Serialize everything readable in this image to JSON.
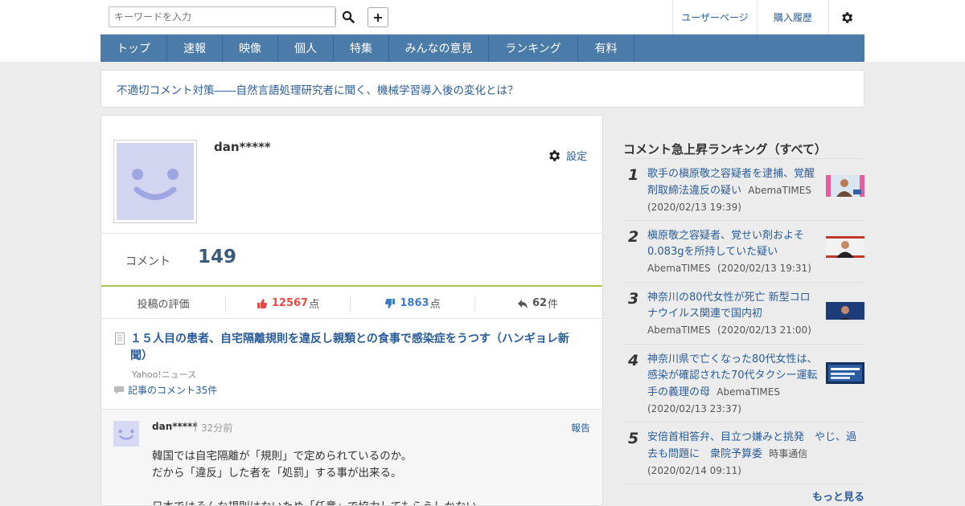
{
  "header": {
    "search_placeholder": "キーワードを入力",
    "links": {
      "user_page": "ユーザーページ",
      "purchase_history": "購入履歴"
    }
  },
  "nav": {
    "items": [
      "トップ",
      "速報",
      "映像",
      "個人",
      "特集",
      "みんなの意見",
      "ランキング",
      "有料"
    ]
  },
  "notice": {
    "text": "不適切コメント対策――自然言語処理研究者に聞く、機械学習導入後の変化とは？"
  },
  "profile": {
    "username": "dan*****",
    "settings_label": "設定"
  },
  "comment_count": {
    "label": "コメント",
    "value": "149"
  },
  "ratings": {
    "label": "投稿の評価",
    "likes": "12567",
    "likes_unit": "点",
    "dislikes": "1863",
    "dislikes_unit": "点",
    "replies": "62",
    "replies_unit": "件"
  },
  "article": {
    "title": "１５人目の患者、自宅隔離規則を違反し親類との食事で感染症をうつす（ハンギョレ新聞）",
    "source": "Yahoo!ニュース",
    "comments_link": "記事のコメント35件"
  },
  "comment": {
    "author": "dan*****",
    "separator": "|",
    "time": "32分前",
    "report": "報告",
    "lines": [
      "韓国では自宅隔離が「規則」で定められているのか。",
      "だから「違反」した者を「処罰」する事が出来る。",
      "",
      "日本ではそんな規則はないため「任意」で協力してもらうしかない。"
    ]
  },
  "ranking": {
    "title": "コメント急上昇ランキング（すべて）",
    "more": "もっと見る",
    "items": [
      {
        "rank": "1",
        "title": "歌手の槇原敬之容疑者を逮捕、覚醒剤取締法違反の疑い",
        "source": "AbemaTIMES",
        "date": "(2020/02/13 19:39)"
      },
      {
        "rank": "2",
        "title": "槇原敬之容疑者、覚せい剤およそ0.083gを所持していた疑い",
        "source": "AbemaTIMES",
        "date": "(2020/02/13 19:31)"
      },
      {
        "rank": "3",
        "title": "神奈川の80代女性が死亡 新型コロナウイルス関連で国内初",
        "source": "AbemaTIMES",
        "date": "(2020/02/13 21:00)"
      },
      {
        "rank": "4",
        "title": "神奈川県で亡くなった80代女性は、感染が確認された70代タクシー運転手の義理の母",
        "source": "AbemaTIMES",
        "date": "(2020/02/13 23:37)"
      },
      {
        "rank": "5",
        "title": "安倍首相答弁、目立つ嫌みと挑発　やじ、過去も問題に　衆院予算委",
        "source": "時事通信",
        "date": "(2020/02/14 09:11)"
      }
    ]
  },
  "colors": {
    "link": "#2a5d99",
    "nav_bg": "#4a7ba9",
    "accent_green": "#a3c64c",
    "like_red": "#e64a47",
    "dislike_blue": "#3f7ec4"
  }
}
